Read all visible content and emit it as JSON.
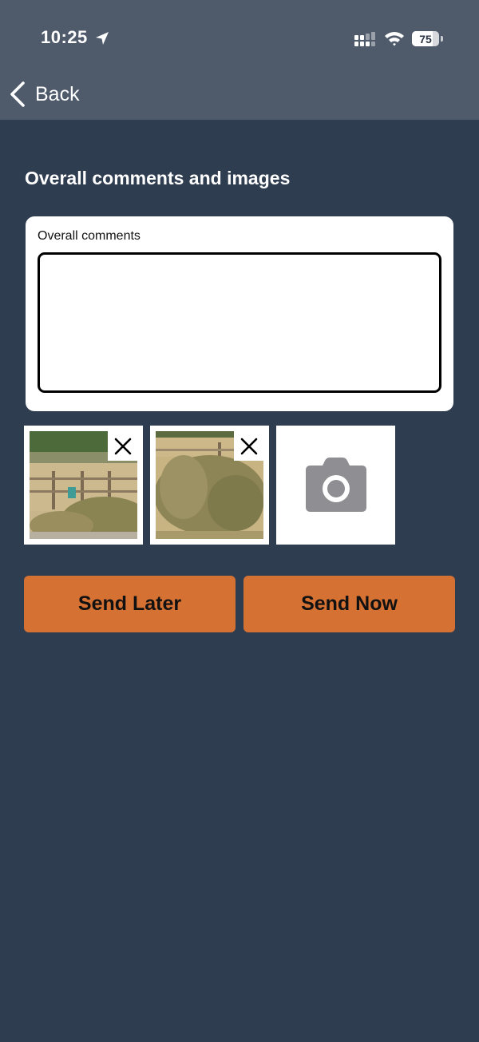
{
  "status_bar": {
    "time": "10:25",
    "battery": "75",
    "battery_level": 0.75,
    "icons": [
      "location-arrow-icon",
      "cellular-signal-icon",
      "wifi-icon",
      "battery-icon"
    ]
  },
  "nav": {
    "back_label": "Back",
    "back_icon": "chevron-left-icon"
  },
  "section": {
    "title": "Overall comments and images"
  },
  "comments": {
    "label": "Overall comments",
    "value": "",
    "placeholder": ""
  },
  "images": {
    "remove_icon": "close-icon",
    "add_icon": "camera-icon",
    "count": 2
  },
  "actions": {
    "send_later_label": "Send Later",
    "send_now_label": "Send Now"
  },
  "colors": {
    "background": "#2f3d51",
    "header": "#4f5b6b",
    "accent_button": "#d47133",
    "camera_icon": "#8e8e93"
  }
}
